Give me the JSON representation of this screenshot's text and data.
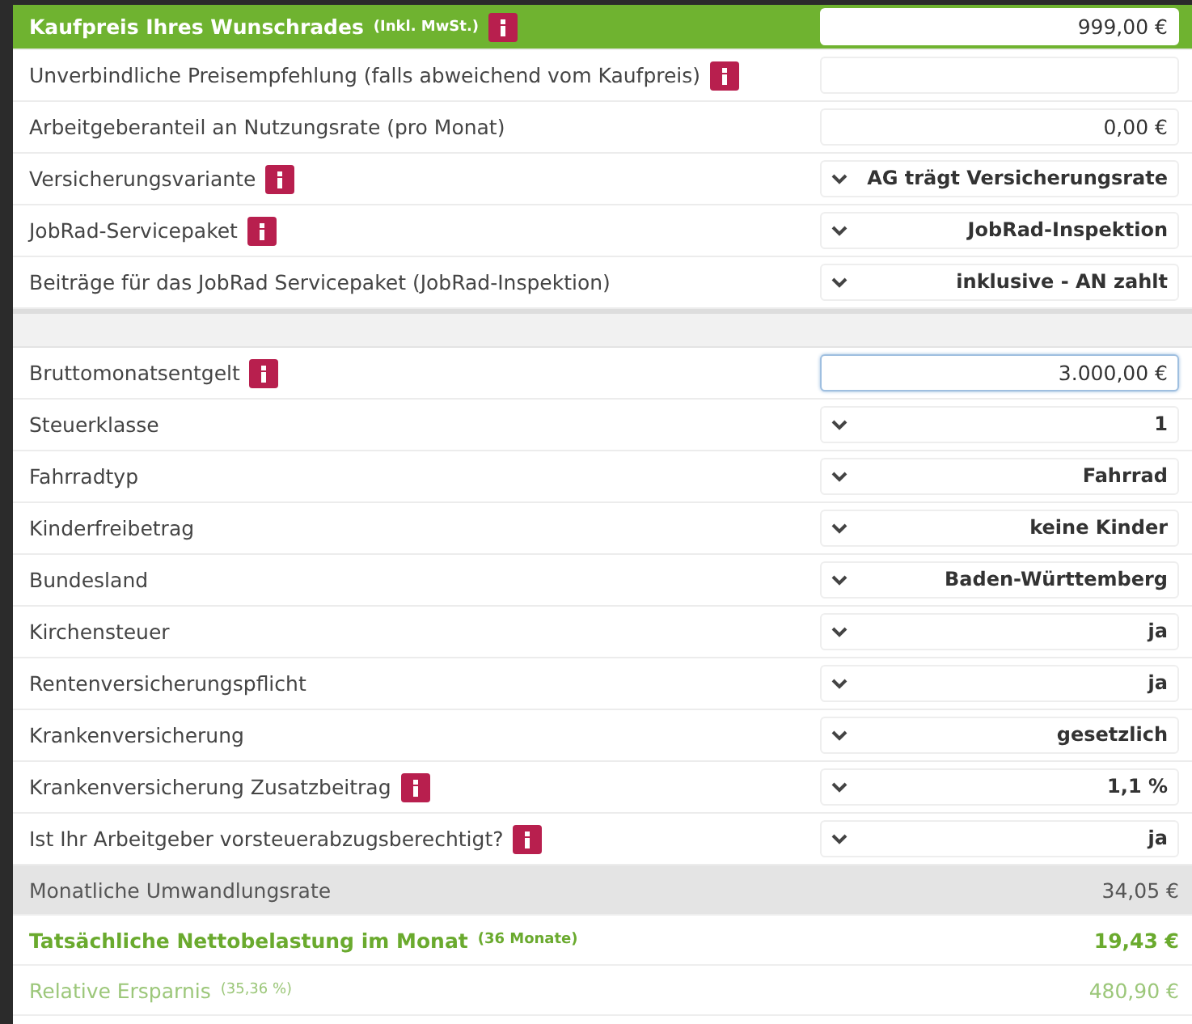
{
  "sections": [
    {
      "rows": [
        {
          "label": "Kaufpreis Ihres Wunschrades",
          "note": "(Inkl. MwSt.)",
          "info": true,
          "header": true,
          "kind": "input",
          "value": "999,00 €",
          "focused": false
        },
        {
          "label": "Unverbindliche Preisempfehlung (falls abweichend vom Kaufpreis)",
          "info": true,
          "header": false,
          "kind": "input",
          "focused": false
        },
        {
          "label": "Arbeitgeberanteil an Nutzungsrate (pro Monat)",
          "info": false,
          "header": false,
          "kind": "input",
          "value": "0,00 €",
          "focused": false
        },
        {
          "label": "Versicherungsvariante",
          "info": true,
          "header": false,
          "kind": "select",
          "value": "AG trägt Versicherungsrate"
        },
        {
          "label": "JobRad-Servicepaket",
          "info": true,
          "header": false,
          "kind": "select",
          "value": "JobRad-Inspektion"
        },
        {
          "label": "Beiträge für das JobRad Servicepaket (JobRad-Inspektion)",
          "info": false,
          "header": false,
          "kind": "select",
          "value": "inklusive - AN zahlt"
        }
      ]
    },
    {
      "rows": [
        {
          "label": "Bruttomonatsentgelt",
          "info": true,
          "header": false,
          "kind": "input",
          "value": "3.000,00 €",
          "focused": true
        },
        {
          "label": "Steuerklasse",
          "info": false,
          "header": false,
          "kind": "select",
          "value": "1"
        },
        {
          "label": "Fahrradtyp",
          "info": false,
          "header": false,
          "kind": "select",
          "value": "Fahrrad"
        },
        {
          "label": "Kinderfreibetrag",
          "info": false,
          "header": false,
          "kind": "select",
          "value": "keine Kinder"
        },
        {
          "label": "Bundesland",
          "info": false,
          "header": false,
          "kind": "select",
          "value": "Baden-Württemberg"
        },
        {
          "label": "Kirchensteuer",
          "info": false,
          "header": false,
          "kind": "select",
          "value": "ja"
        },
        {
          "label": "Rentenversicherungspflicht",
          "info": false,
          "header": false,
          "kind": "select",
          "value": "ja"
        },
        {
          "label": "Krankenversicherung",
          "info": false,
          "header": false,
          "kind": "select",
          "value": "gesetzlich"
        },
        {
          "label": "Krankenversicherung Zusatzbeitrag",
          "info": true,
          "header": false,
          "kind": "select",
          "value": "1,1 %"
        },
        {
          "label": "Ist Ihr Arbeitgeber vorsteuerabzugsberechtigt?",
          "info": true,
          "header": false,
          "kind": "select",
          "value": "ja"
        }
      ]
    }
  ],
  "results": [
    {
      "kind": "neutral",
      "label": "Monatliche Umwandlungsrate",
      "value": "34,05 €"
    },
    {
      "kind": "highlight",
      "label": "Tatsächliche Nettobelastung im Monat",
      "note": "(36 Monate)",
      "value": "19,43 €"
    },
    {
      "kind": "muted",
      "label": "Relative Ersparnis",
      "note": "(35,36 %)",
      "value": "480,90 €"
    }
  ]
}
